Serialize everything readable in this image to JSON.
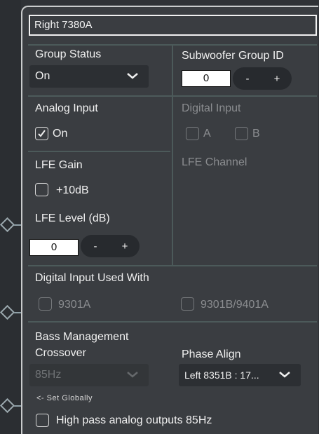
{
  "title": "Right 7380A",
  "group_status": {
    "label": "Group Status",
    "value": "On"
  },
  "subwoofer_group": {
    "label": "Subwoofer Group ID",
    "value": "0",
    "minus": "-",
    "plus": "+"
  },
  "analog_input": {
    "label": "Analog Input",
    "option": "On",
    "checked": true
  },
  "digital_input": {
    "label": "Digital Input",
    "options": [
      "A",
      "B"
    ]
  },
  "lfe_gain": {
    "label": "LFE Gain",
    "option": "+10dB",
    "checked": false
  },
  "lfe_channel": {
    "label": "LFE Channel"
  },
  "lfe_level": {
    "label": "LFE Level (dB)",
    "value": "0",
    "minus": "-",
    "plus": "+"
  },
  "digital_input_used_with": {
    "label": "Digital Input Used With",
    "options": [
      "9301A",
      "9301B/9401A"
    ]
  },
  "bass_management": {
    "label_line1": "Bass Management",
    "label_line2": "Crossover",
    "value": "85Hz",
    "note": "<- Set Globally"
  },
  "phase_align": {
    "label": "Phase Align",
    "value": "Left 8351B : 17..."
  },
  "high_pass": {
    "label": "High pass analog outputs 85Hz",
    "checked": false
  }
}
